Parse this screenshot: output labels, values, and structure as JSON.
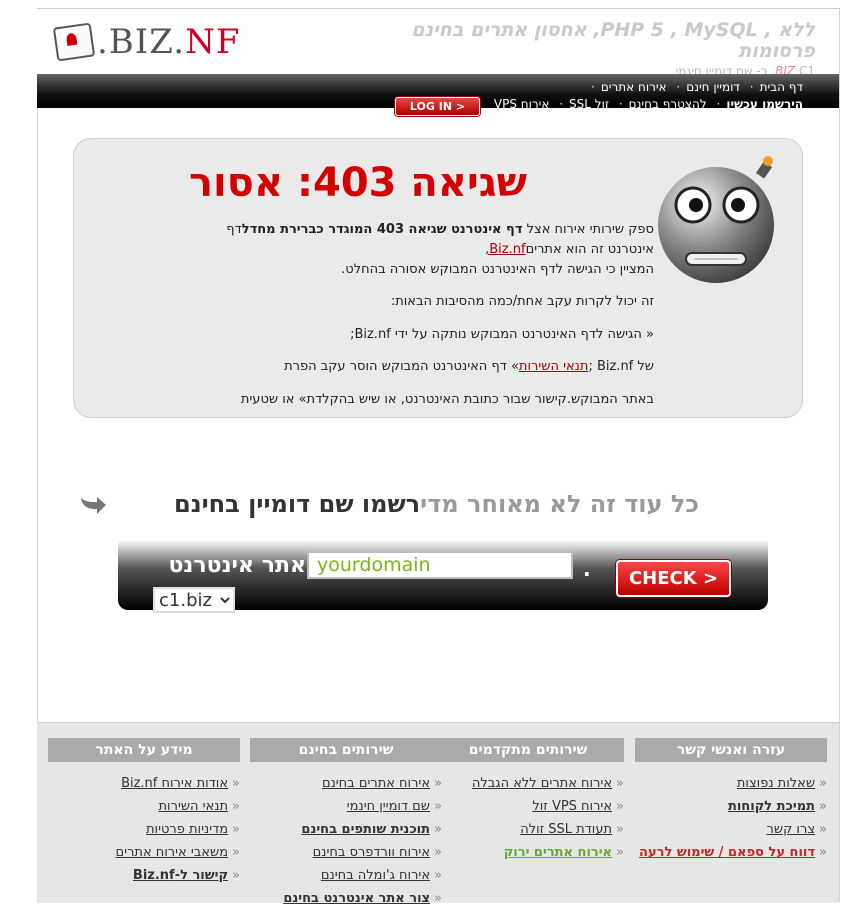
{
  "header": {
    "logo_prefix": ".BIZ.",
    "logo_suffix": "NF",
    "tagline": "ללא , PHP 5 , MySQL, אחסון אתרים בחינם פרסומות",
    "subtag_biz": "BIZ",
    "subtag_text": "C1. ב- שם דומיין חינמי"
  },
  "nav": {
    "row1": [
      "דף הבית",
      "דומיין חינם",
      "אירוח אתרים"
    ],
    "row2": [
      "הירשמו עכשיו",
      "להצטרף בחינם",
      "זול SSL",
      "אירוח VPS"
    ],
    "login_label": "LOG IN >"
  },
  "error": {
    "title": "שגיאה 403: אסור",
    "p1_a": "ספק שירותי אירוח אצל ",
    "p1_b": "דף אינטרנט שגיאה 403 המוגדר כברירת מחדל",
    "p1_c": "דף אינטרנט זה הוא אתרים",
    "p1_link": "Biz.nf,",
    "p1_d": "המציין כי הגישה לדף האינטרנט המבוקש אסורה בהחלט.",
    "p2": "זה יכול לקרות עקב אחת/כמה מהסיבות הבאות:",
    "p3": "« הגישה לדף האינטרנט המבוקש נותקה על ידי Biz.nf;",
    "p4_a": "של Biz.nf ;",
    "p4_link": "תנאי השירות",
    "p4_b": "» דף האינטרנט המבוקש הוסר עקב הפרת",
    "p5": "באתר המבוקש.קישור שבור כתובת האינטרנט, או שיש בהקלדת» או שטעית"
  },
  "domain": {
    "heading_gray": "כל עוד זה לא מאוחר מדי",
    "heading_dark": "רשמו שם דומיין בחינם",
    "label": "אתר אינטרנט",
    "input_value": "yourdomain",
    "dot": ".",
    "tld": "c1.biz",
    "check_label": "CHECK >"
  },
  "footer": {
    "columns": [
      {
        "title": "מידע על האתר",
        "items": [
          "אודות אירוח Biz.nf",
          "תנאי השירות",
          "מדיניות פרטיות",
          "משאבי אירוח אתרים",
          "קישור ל-Biz.nf"
        ]
      },
      {
        "title": "שירותים בחינם",
        "items": [
          "אירוח אתרים בחינם",
          "שם דומיין חינמי",
          "תוכנית שותפים בחינם",
          "אירוח וורדפרס בחינם",
          "אירוח ג'ומלה בחינם",
          "צור אתר אינטרנט בחינם"
        ]
      },
      {
        "title": "שירותים מתקדמים",
        "items": [
          "אירוח אתרים ללא הגבלה",
          "אירוח VPS זול",
          "תעודת SSL זולה",
          "אירוח אתרים ירוק"
        ]
      },
      {
        "title": "עזרה ואנשי קשר",
        "items": [
          "שאלות נפוצות",
          "תמיכת לקוחות",
          "צרו קשר",
          "דווח על ספאם / שימוש לרעה"
        ]
      }
    ]
  }
}
